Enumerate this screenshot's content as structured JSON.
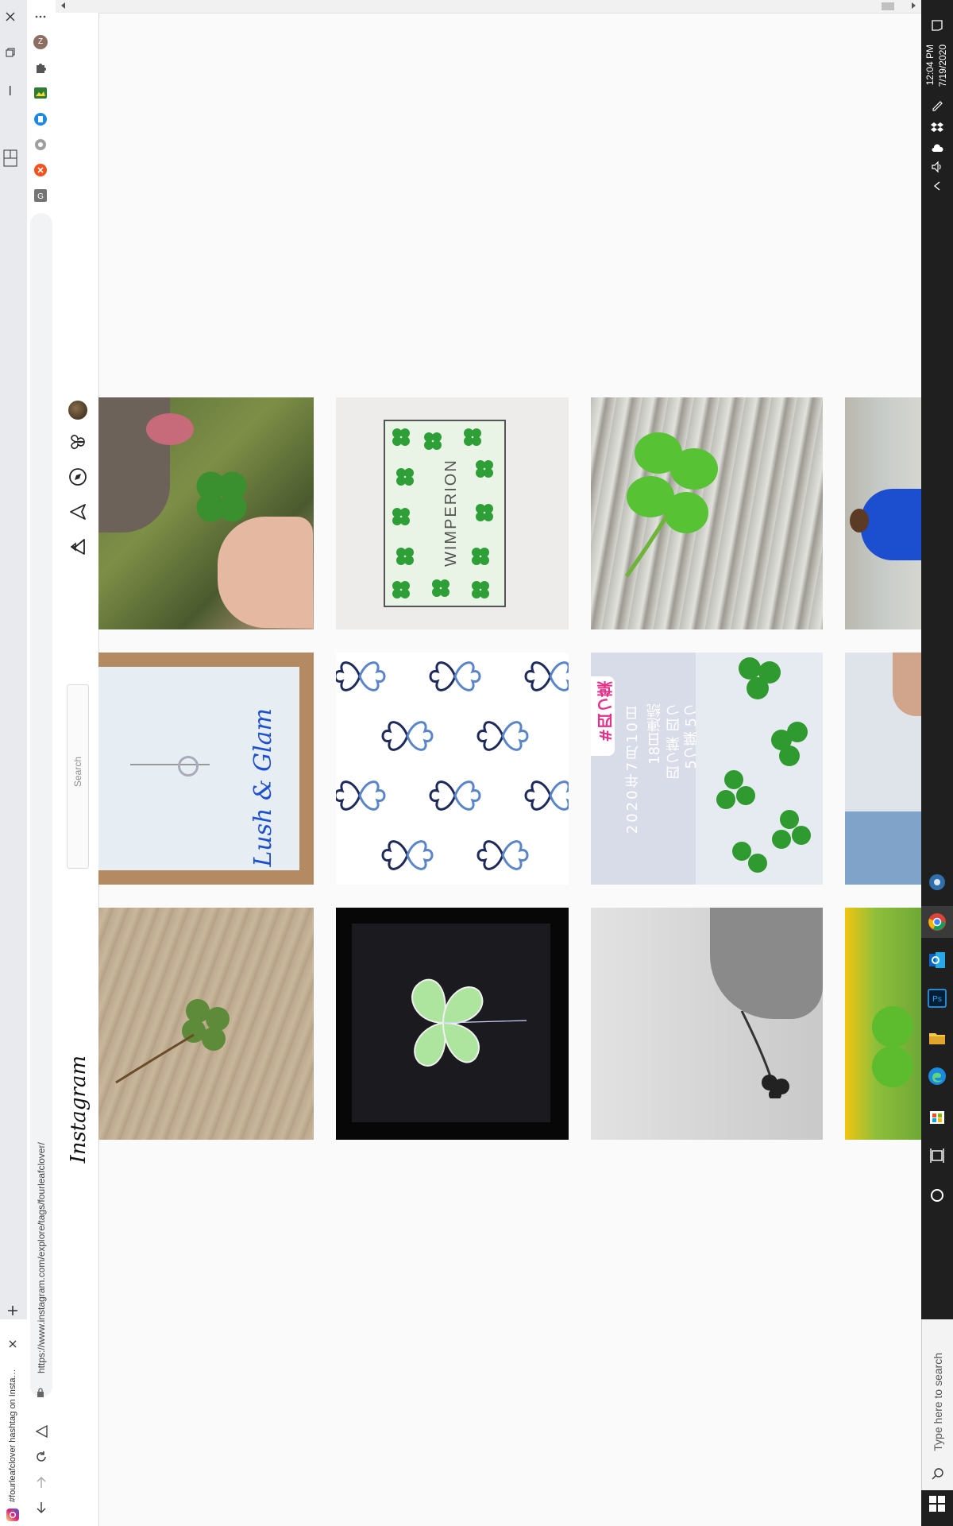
{
  "browser": {
    "tab_title": "#fourleafclover hashtag on Insta…",
    "url": "https://www.instagram.com/explore/tags/fourleafclover/",
    "profile_initial": "Z"
  },
  "instagram": {
    "logo": "Instagram",
    "search_placeholder": "Search"
  },
  "tiles": [
    {
      "id": "r1c1",
      "desc": "dog clover"
    },
    {
      "id": "r1c2",
      "overlay": "WIMPERION"
    },
    {
      "id": "r1c3",
      "desc": "clover on wood"
    },
    {
      "id": "r1c4",
      "desc": "person blue shirt"
    },
    {
      "id": "r2c1",
      "overlay": "Lush & Glam"
    },
    {
      "id": "r2c2",
      "desc": "blue clover pattern"
    },
    {
      "id": "r2c3",
      "hashtag": "#四つ葉",
      "caption_1": "2020年7月10日",
      "caption_2": "18日連続",
      "caption_3": "四つ葉 四つ",
      "caption_4": "5つ葉 5つ"
    },
    {
      "id": "r2c4",
      "desc": "shirt"
    },
    {
      "id": "r3c1",
      "desc": "clover on table"
    },
    {
      "id": "r3c2",
      "desc": "drawn green clover"
    },
    {
      "id": "r3c3",
      "desc": "hand holding clover"
    },
    {
      "id": "r3c4",
      "desc": "clover yellow background"
    }
  ],
  "taskbar": {
    "time": "12:04 PM",
    "date": "7/19/2020",
    "search_placeholder": "Type here to search"
  },
  "colors": {
    "clover_green": "#2e9e37",
    "taskbar": "#1f1f1f",
    "ig_border": "#dbdbdb"
  }
}
